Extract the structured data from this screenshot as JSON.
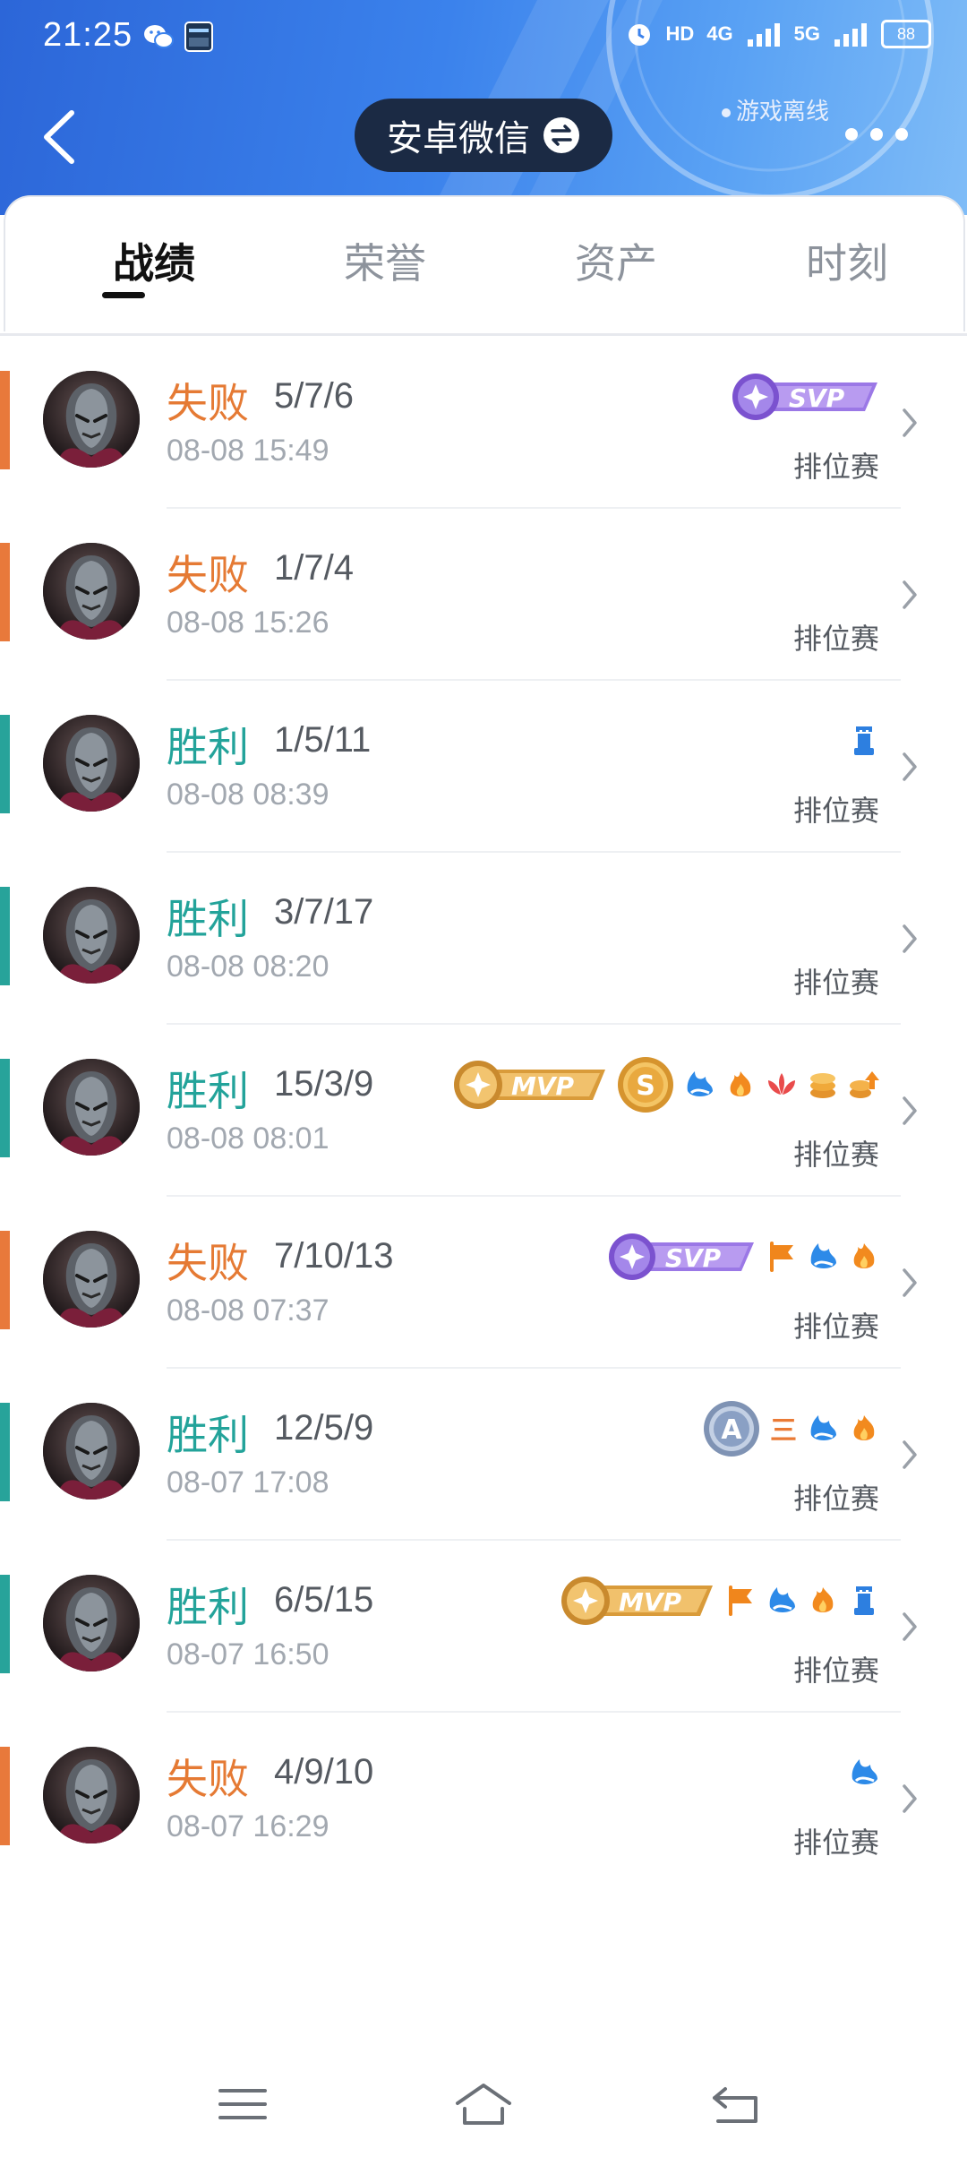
{
  "status_bar": {
    "time": "21:25",
    "hd_label": "HD",
    "net_label": "4G",
    "net_label2": "5G",
    "battery": "88",
    "icons": [
      "wechat-icon",
      "app-thumbnail-icon",
      "alarm-icon",
      "signal-icon",
      "signal-icon",
      "battery-icon"
    ]
  },
  "header": {
    "account_name": "安卓微信",
    "offline_status": "游戏离线",
    "icons": [
      "back-arrow-icon",
      "swap-icon",
      "more-dots-icon"
    ]
  },
  "tabs": [
    {
      "label": "战绩",
      "active": true
    },
    {
      "label": "荣誉",
      "active": false
    },
    {
      "label": "资产",
      "active": false
    },
    {
      "label": "时刻",
      "active": false
    }
  ],
  "matches": [
    {
      "result": "失败",
      "outcome": "loss",
      "kda": "5/7/6",
      "time": "08-08 15:49",
      "mode": "排位赛",
      "badges": [
        "svp"
      ]
    },
    {
      "result": "失败",
      "outcome": "loss",
      "kda": "1/7/4",
      "time": "08-08 15:26",
      "mode": "排位赛",
      "badges": []
    },
    {
      "result": "胜利",
      "outcome": "win",
      "kda": "1/5/11",
      "time": "08-08 08:39",
      "mode": "排位赛",
      "badges": [
        "tower"
      ]
    },
    {
      "result": "胜利",
      "outcome": "win",
      "kda": "3/7/17",
      "time": "08-08 08:20",
      "mode": "排位赛",
      "badges": []
    },
    {
      "result": "胜利",
      "outcome": "win",
      "kda": "15/3/9",
      "time": "08-08 08:01",
      "mode": "排位赛",
      "badges": [
        "mvp",
        "s",
        "splash",
        "fire",
        "flower",
        "coins",
        "coin-up"
      ]
    },
    {
      "result": "失败",
      "outcome": "loss",
      "kda": "7/10/13",
      "time": "08-08 07:37",
      "mode": "排位赛",
      "badges": [
        "svp",
        "flag",
        "splash",
        "fire"
      ]
    },
    {
      "result": "胜利",
      "outcome": "win",
      "kda": "12/5/9",
      "time": "08-07 17:08",
      "mode": "排位赛",
      "badges": [
        "a",
        "three",
        "splash",
        "fire"
      ]
    },
    {
      "result": "胜利",
      "outcome": "win",
      "kda": "6/5/15",
      "time": "08-07 16:50",
      "mode": "排位赛",
      "badges": [
        "mvp",
        "flag",
        "splash",
        "fire",
        "tower"
      ]
    },
    {
      "result": "失败",
      "outcome": "loss",
      "kda": "4/9/10",
      "time": "08-07 16:29",
      "mode": "排位赛",
      "badges": [
        "splash"
      ]
    }
  ],
  "badge_text": {
    "svp": "SVP",
    "mvp": "MVP",
    "s": "S",
    "a": "A",
    "three": "三"
  },
  "colors": {
    "win": "#27a39a",
    "loss": "#e8793b",
    "header_blue": "#3b82ec",
    "svp_purple": "#8b5fd6",
    "mvp_gold": "#e6a23a"
  },
  "navbar": {
    "icons": [
      "menu-icon",
      "home-icon",
      "back-icon"
    ]
  }
}
